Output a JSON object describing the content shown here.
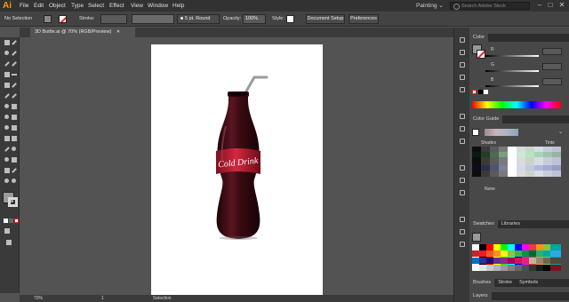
{
  "app": {
    "logo": "Ai",
    "workspace": "Painting ⌄",
    "search_placeholder": "Search Adobe Stock"
  },
  "menu": [
    "File",
    "Edit",
    "Object",
    "Type",
    "Select",
    "Effect",
    "View",
    "Window",
    "Help"
  ],
  "window_controls": [
    "–",
    "□",
    "✕"
  ],
  "control_bar": {
    "selection": "No Selection",
    "stroke_label": "Stroke:",
    "brush": "5 pt. Round",
    "opacity_label": "Opacity:",
    "opacity_value": "100%",
    "style_label": "Style:",
    "document_setup": "Document Setup",
    "preferences": "Preferences"
  },
  "document": {
    "tab_title": "3D Bottle.ai @ 70% (RGB/Preview)",
    "tab_close": "✕"
  },
  "artwork": {
    "label": "Cold Drink",
    "colors": {
      "bottle": "#3a0a12",
      "label": "#c21f35"
    }
  },
  "status": {
    "zoom": "70%",
    "page": "1",
    "mode": "Selection"
  },
  "panels": {
    "color": {
      "title": "Color",
      "channels": [
        "R",
        "G",
        "B"
      ]
    },
    "color_guide": {
      "title": "Color Guide",
      "shades": "Shades",
      "tints": "Tints",
      "none": "None"
    },
    "swatches_tabs": [
      "Swatches",
      "Libraries"
    ],
    "brush_tabs": [
      "Brushes",
      "Stroke",
      "Symbols"
    ],
    "layers": "Layers"
  },
  "colors": {
    "accent": "#ff9a00",
    "menubar": "#323232",
    "panel": "#484848",
    "canvas": "#535353"
  }
}
